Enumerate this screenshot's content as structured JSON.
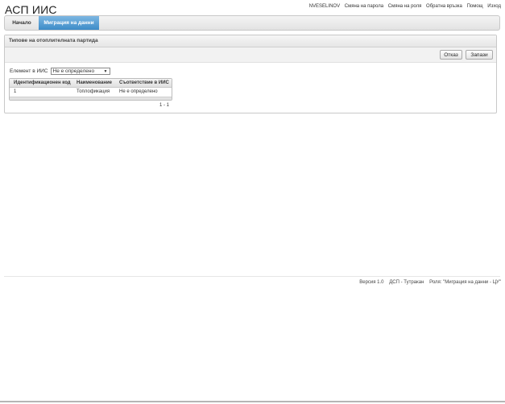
{
  "app": {
    "title": "АСП ИИС"
  },
  "top_links": {
    "user": "NVESELINOV",
    "change_password": "Смяна на парола",
    "change_role": "Смяна на роля",
    "feedback": "Обратна връзка",
    "help": "Помощ",
    "logout": "Изход"
  },
  "nav": {
    "tabs": [
      {
        "label": "Начало",
        "active": false
      },
      {
        "label": "Миграция на данни",
        "active": true
      }
    ]
  },
  "panel": {
    "title": "Типове на отоплителната партида",
    "buttons": {
      "cancel": "Отказ",
      "save": "Запази"
    },
    "filter": {
      "label": "Елемент в ИИС",
      "selected": "Не е определено"
    },
    "table": {
      "columns": [
        "Идентификационен код",
        "Наименование",
        "Съответствие в ИИС"
      ],
      "rows": [
        [
          "1",
          "Топлофикация",
          "Не е определено"
        ]
      ]
    },
    "pager": "1 - 1"
  },
  "footer": {
    "version": "Версия 1.0",
    "office": "ДСП - Тутракан",
    "role": "Роля: \"Миграция на данни - ЦУ\""
  }
}
